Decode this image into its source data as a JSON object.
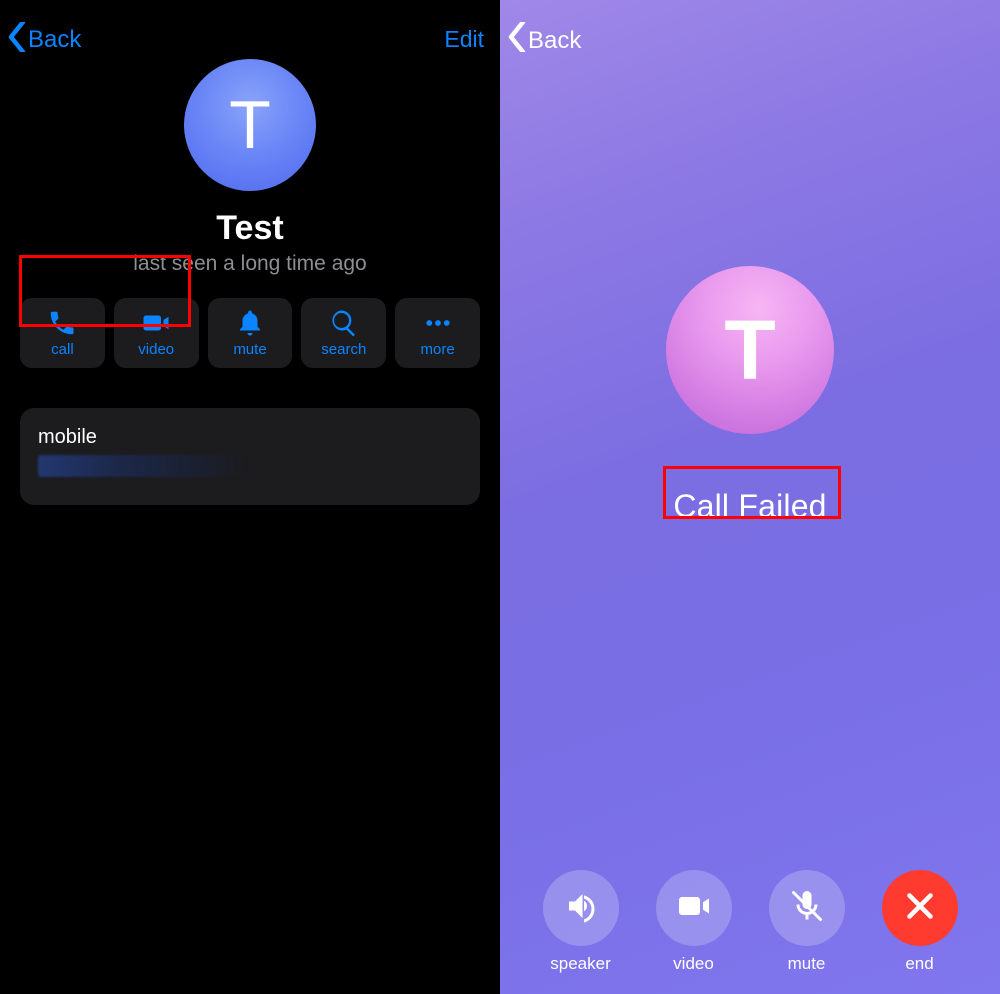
{
  "left": {
    "back_label": "Back",
    "edit_label": "Edit",
    "avatar_letter": "T",
    "contact_name": "Test",
    "contact_status": "last seen a long time ago",
    "actions": {
      "call": "call",
      "video": "video",
      "mute": "mute",
      "search": "search",
      "more": "more"
    },
    "phone_section": {
      "label": "mobile",
      "number_masked": "+"
    }
  },
  "right": {
    "back_label": "Back",
    "avatar_letter": "T",
    "call_status": "Call Failed",
    "controls": {
      "speaker": "speaker",
      "video": "video",
      "mute": "mute",
      "end": "end"
    }
  },
  "highlights": {
    "call_video_box": true,
    "call_failed_box": true
  },
  "colors": {
    "ios_blue": "#0a84ff",
    "end_red": "#ff3b30",
    "highlight_red": "#ff0000"
  }
}
